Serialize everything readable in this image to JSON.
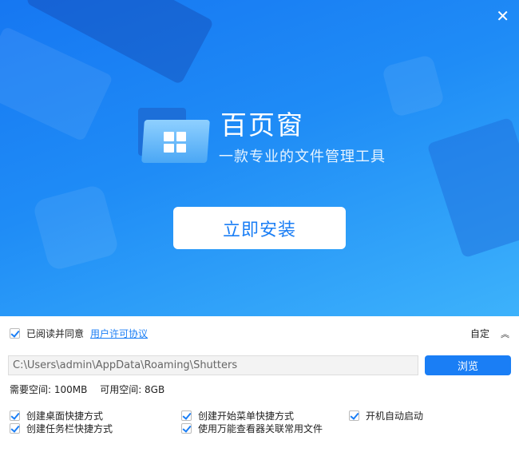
{
  "header": {
    "title": "百页窗",
    "subtitle": "一款专业的文件管理工具",
    "install_label": "立即安装",
    "close_icon": "close-icon"
  },
  "agreement": {
    "checked": true,
    "text": "已阅读并同意",
    "link": "用户许可协议",
    "custom_label": "自定"
  },
  "install_path": {
    "value": "C:\\Users\\admin\\AppData\\Roaming\\Shutters",
    "browse_label": "浏览"
  },
  "space": {
    "required": "需要空间: 100MB",
    "available": "可用空间: 8GB"
  },
  "options": [
    {
      "label": "创建桌面快捷方式",
      "checked": true
    },
    {
      "label": "创建开始菜单快捷方式",
      "checked": true
    },
    {
      "label": "开机自动启动",
      "checked": true
    },
    {
      "label": "创建任务栏快捷方式",
      "checked": true
    },
    {
      "label": "使用万能查看器关联常用文件",
      "checked": true
    }
  ],
  "colors": {
    "accent": "#1a7ef5"
  }
}
